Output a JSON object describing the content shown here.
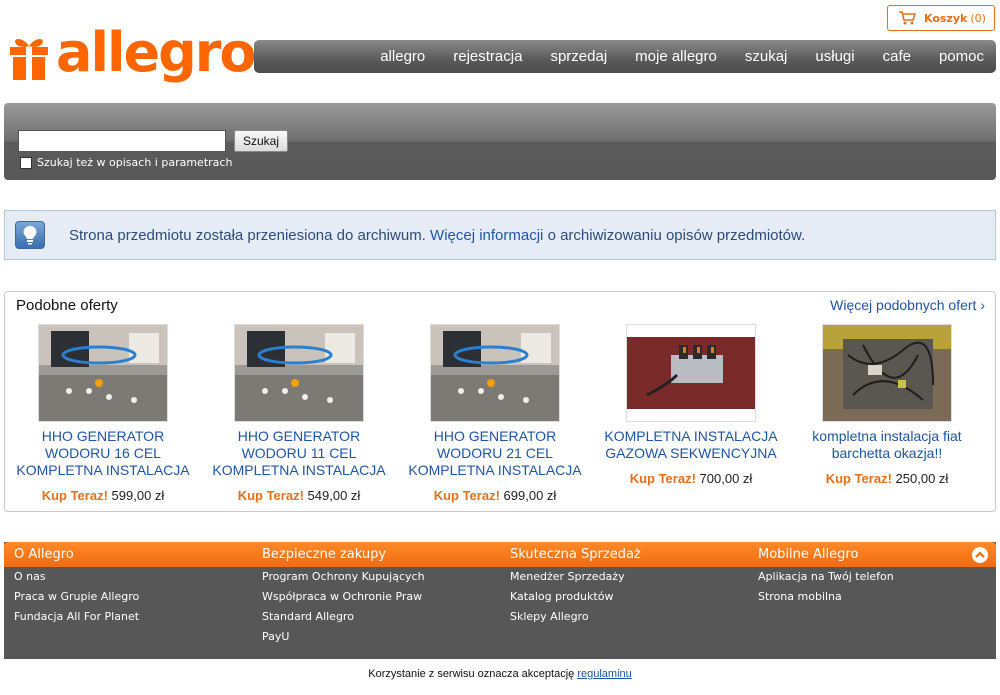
{
  "logo": {
    "text": "allegro"
  },
  "cart": {
    "label": "Koszyk",
    "count": "(0)"
  },
  "nav": [
    "allegro",
    "rejestracja",
    "sprzedaj",
    "moje allegro",
    "szukaj",
    "usługi",
    "cafe",
    "pomoc"
  ],
  "search": {
    "value": "",
    "button": "Szukaj",
    "checkbox_label": "Szukaj też w opisach i parametrach",
    "checkbox_checked": false
  },
  "info": {
    "text_before": "Strona przedmiotu została przeniesiona do archiwum.",
    "link": "Więcej informacji",
    "text_after": "o archiwizowaniu opisów przedmiotów."
  },
  "similar": {
    "title": "Podobne oferty",
    "more": "Więcej podobnych ofert ›",
    "offers": [
      {
        "name": "HHO GENERATOR WODORU 16 CEL KOMPLETNA INSTALACJA",
        "price_label": "Kup Teraz!",
        "price": "599,00 zł"
      },
      {
        "name": "HHO GENERATOR WODORU 11 CEL KOMPLETNA INSTALACJA",
        "price_label": "Kup Teraz!",
        "price": "549,00 zł"
      },
      {
        "name": "HHO GENERATOR WODORU 21 CEL KOMPLETNA INSTALACJA",
        "price_label": "Kup Teraz!",
        "price": "699,00 zł"
      },
      {
        "name": "KOMPLETNA INSTALACJA GAZOWA SEKWENCYJNA",
        "price_label": "Kup Teraz!",
        "price": "700,00 zł"
      },
      {
        "name": "kompletna instalacja fiat barchetta okazja!!",
        "price_label": "Kup Teraz!",
        "price": "250,00 zł"
      }
    ]
  },
  "footer": {
    "columns": [
      {
        "title": "O Allegro",
        "links": [
          "O nas",
          "Praca w Grupie Allegro",
          "Fundacja All For Planet"
        ]
      },
      {
        "title": "Bezpieczne zakupy",
        "links": [
          "Program Ochrony Kupujących",
          "Współpraca w Ochronie Praw",
          "Standard Allegro",
          "PayU"
        ]
      },
      {
        "title": "Skuteczna Sprzedaż",
        "links": [
          "Menedżer Sprzedaży",
          "Katalog produktów",
          "Sklepy Allegro"
        ]
      },
      {
        "title": "Mobilne Allegro",
        "links": [
          "Aplikacja na Twój telefon",
          "Strona mobilna"
        ]
      }
    ]
  },
  "terms": {
    "text": "Korzystanie z serwisu oznacza akceptację",
    "link": "regulaminu"
  },
  "colors": {
    "brand": "#ff6600",
    "link": "#1f55a8",
    "footer_bg": "#575757"
  }
}
